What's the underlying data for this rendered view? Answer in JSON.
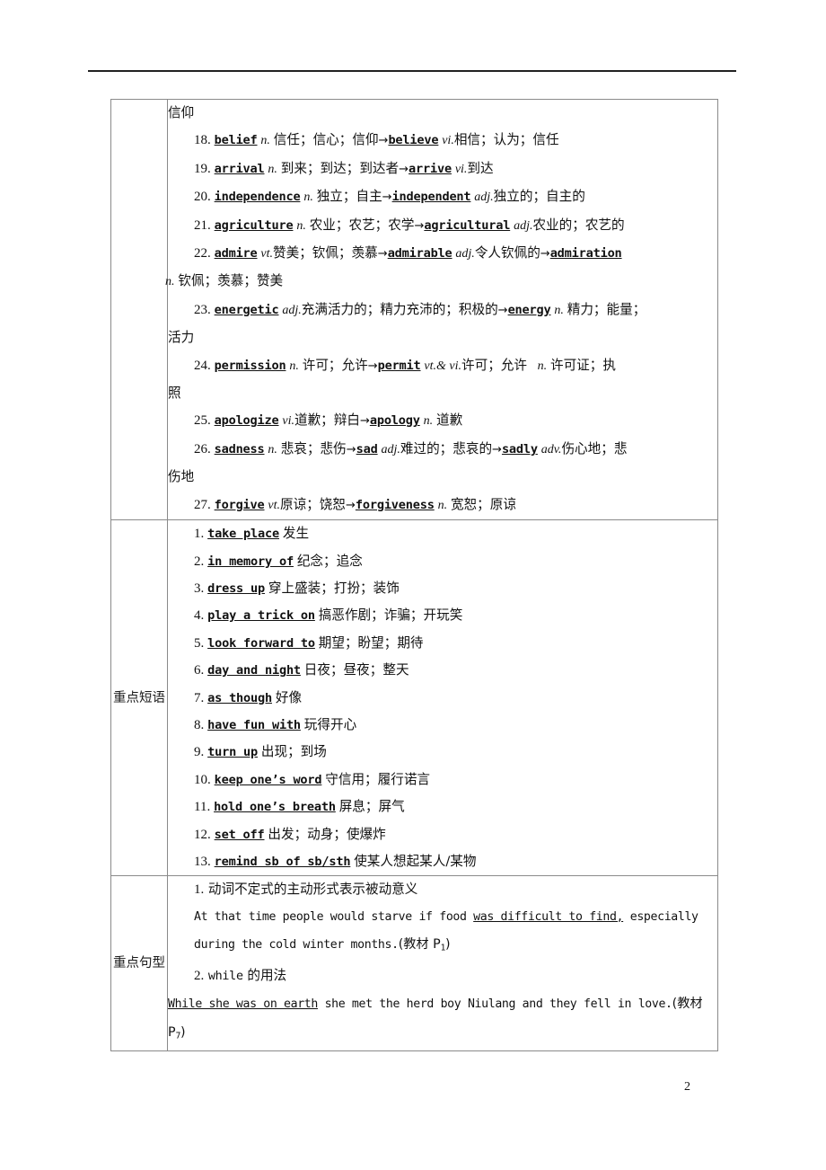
{
  "page": {
    "number": "2"
  },
  "table": {
    "sections": [
      {
        "label": "",
        "kind": "vocabulary",
        "lead_text": "信仰",
        "entries": [
          {
            "num": "18.",
            "head": "belief",
            "pos": "n.",
            "gloss": "信任；信心；信仰",
            "arrow": "→",
            "derived": "believe",
            "derived_pos": "vi.",
            "derived_gloss": "相信；认为；信任"
          },
          {
            "num": "19.",
            "head": "arrival",
            "pos": "n.",
            "gloss": "到来；到达；到达者",
            "arrow": "→",
            "derived": "arrive",
            "derived_pos": "vi.",
            "derived_gloss": "到达"
          },
          {
            "num": "20.",
            "head": "independence",
            "pos": "n.",
            "gloss": "独立；自主",
            "arrow": "→",
            "derived": "independent",
            "derived_pos": "adj.",
            "derived_gloss": "独立的；自主的"
          },
          {
            "num": "21.",
            "head": "agriculture",
            "pos": "n.",
            "gloss": "农业；农艺；农学",
            "arrow": "→",
            "derived": "agricultural",
            "derived_pos": "adj.",
            "derived_gloss": "农业的；农艺的"
          },
          {
            "num": "22.",
            "head": "admire",
            "pos": "vt.",
            "gloss": "赞美；钦佩；羡慕",
            "arrow": "→",
            "derived": "admirable",
            "derived_pos": "adj.",
            "derived_gloss": "令人钦佩的",
            "arrow2": "→",
            "derived2": "admiration",
            "derived2_pos": "n.",
            "derived2_gloss": "钦佩；羡慕；赞美"
          },
          {
            "num": "23.",
            "head": "energetic",
            "pos": "adj.",
            "gloss": "充满活力的；精力充沛的；积极的",
            "arrow": "→",
            "derived": "energy",
            "derived_pos": "n.",
            "derived_gloss": "精力；能量；活力"
          },
          {
            "num": "24.",
            "head": "permission",
            "pos": "n.",
            "gloss": "许可；允许",
            "arrow": "→",
            "derived": "permit",
            "derived_pos": "vt.& vi.",
            "derived_gloss": "许可；允许",
            "derived_pos2": "n.",
            "derived_gloss2": "许可证；执照"
          },
          {
            "num": "25.",
            "head": "apologize",
            "pos": "vi.",
            "gloss": "道歉；辩白",
            "arrow": "→",
            "derived": "apology",
            "derived_pos": "n.",
            "derived_gloss": "道歉"
          },
          {
            "num": "26.",
            "head": "sadness",
            "pos": "n.",
            "gloss": "悲哀；悲伤",
            "arrow": "→",
            "derived": "sad",
            "derived_pos": "adj.",
            "derived_gloss": "难过的；悲哀的",
            "arrow2": "→",
            "derived2": "sadly",
            "derived2_pos": "adv.",
            "derived2_gloss": "伤心地；悲伤地"
          },
          {
            "num": "27.",
            "head": "forgive",
            "pos": "vt.",
            "gloss": "原谅；饶恕",
            "arrow": "→",
            "derived": "forgiveness",
            "derived_pos": "n.",
            "derived_gloss": "宽恕；原谅"
          }
        ]
      },
      {
        "label": "重点短语",
        "kind": "phrases",
        "entries": [
          {
            "num": "1.",
            "phrase": "take place",
            "gloss": "发生"
          },
          {
            "num": "2.",
            "phrase": "in memory of",
            "gloss": "纪念；追念"
          },
          {
            "num": "3.",
            "phrase": "dress  up",
            "gloss": "穿上盛装；打扮；装饰"
          },
          {
            "num": "4.",
            "phrase": "play a trick on",
            "gloss": "搞恶作剧；诈骗；开玩笑"
          },
          {
            "num": "5.",
            "phrase": "look forward to",
            "gloss": "期望；盼望；期待"
          },
          {
            "num": "6.",
            "phrase": "day and night",
            "gloss": "日夜；昼夜；整天"
          },
          {
            "num": "7.",
            "phrase": "as though",
            "gloss": "好像"
          },
          {
            "num": "8.",
            "phrase": "have fun with",
            "gloss": "玩得开心"
          },
          {
            "num": "9.",
            "phrase": "turn up",
            "gloss": "出现；到场"
          },
          {
            "num": "10.",
            "phrase": "keep one’s word",
            "gloss": "守信用；履行诺言"
          },
          {
            "num": "11.",
            "phrase": "hold one’s breath",
            "gloss": "屏息；屏气"
          },
          {
            "num": "12.",
            "phrase": "set off",
            "gloss": "出发；动身；使爆炸"
          },
          {
            "num": "13.",
            "phrase": "remind sb of sb/sth",
            "gloss": "使某人想起某人/某物"
          }
        ]
      },
      {
        "label": "重点句型",
        "kind": "patterns",
        "items": [
          {
            "num": "1.",
            "title": "动词不定式的主动形式表示被动意义",
            "example_pre": "At that time people would starve if food ",
            "example_underline": "was difficult to find,",
            "example_post": " especially during the cold winter months.",
            "source_open": "(教材 P",
            "source_sub": "1",
            "source_close": ")"
          },
          {
            "num": "2.",
            "title_en": "while",
            "title_cn": "的用法",
            "example_underline": "While she was on earth",
            "example_post": " she met the herd boy Niulang and they fell in love.",
            "source_open": "(教材 P",
            "source_sub": "7",
            "source_close": ")"
          }
        ]
      }
    ]
  }
}
